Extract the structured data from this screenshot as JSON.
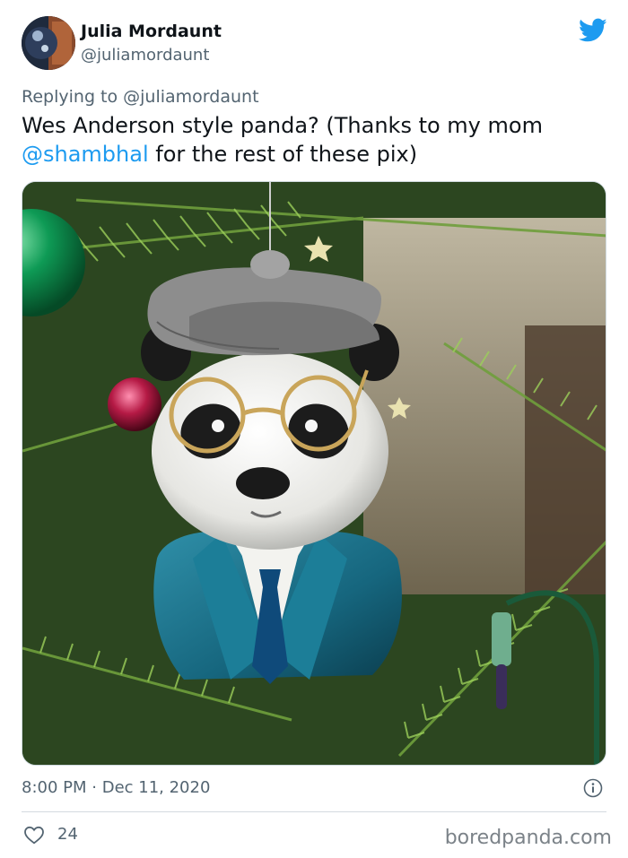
{
  "author": {
    "display_name": "Julia Mordaunt",
    "handle": "@juliamordaunt"
  },
  "reply": {
    "prefix": "Replying to ",
    "mention": "@juliamordaunt"
  },
  "tweet": {
    "text_before_link": "Wes Anderson style panda? (Thanks to my mom ",
    "link_text": "@shambhal",
    "text_after_link": " for the rest of these pix)"
  },
  "photo": {
    "subject": "panda ornament in glasses, cap and blue suit hanging on a christmas tree"
  },
  "meta": {
    "time": "8:00 PM",
    "separator": " · ",
    "date": "Dec 11, 2020"
  },
  "engagement": {
    "likes": "24"
  },
  "watermark": "boredpanda.com",
  "icons": {
    "logo": "twitter-bird-icon",
    "info": "info-icon",
    "like": "heart-icon"
  },
  "colors": {
    "link": "#1d9bf0",
    "secondary_text": "#536471",
    "twitter_blue": "#1d9bf0"
  }
}
